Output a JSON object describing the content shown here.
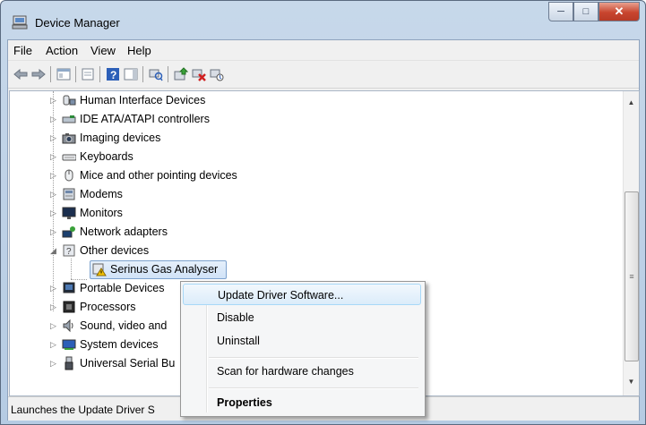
{
  "window": {
    "title": "Device Manager"
  },
  "menubar": [
    "File",
    "Action",
    "View",
    "Help"
  ],
  "tree": {
    "items": [
      {
        "label": "Human Interface Devices",
        "icon": "hid-icon"
      },
      {
        "label": "IDE ATA/ATAPI controllers",
        "icon": "ide-controller-icon"
      },
      {
        "label": "Imaging devices",
        "icon": "camera-icon"
      },
      {
        "label": "Keyboards",
        "icon": "keyboard-icon"
      },
      {
        "label": "Mice and other pointing devices",
        "icon": "mouse-icon"
      },
      {
        "label": "Modems",
        "icon": "modem-icon"
      },
      {
        "label": "Monitors",
        "icon": "monitor-icon"
      },
      {
        "label": "Network adapters",
        "icon": "network-adapter-icon"
      },
      {
        "label": "Other devices",
        "icon": "unknown-device-icon",
        "expanded": true
      },
      {
        "label": "Serinus Gas Analyser",
        "icon": "warning-device-icon",
        "child": true,
        "selected": true
      },
      {
        "label": "Portable Devices",
        "icon": "portable-device-icon"
      },
      {
        "label": "Processors",
        "icon": "processor-icon"
      },
      {
        "label": "Sound, video and",
        "icon": "speaker-icon"
      },
      {
        "label": "System devices",
        "icon": "system-device-icon"
      },
      {
        "label": "Universal Serial Bu",
        "icon": "usb-icon"
      }
    ]
  },
  "context_menu": {
    "items": [
      {
        "label": "Update Driver Software...",
        "highlighted": true
      },
      {
        "label": "Disable"
      },
      {
        "label": "Uninstall"
      },
      {
        "label": "Scan for hardware changes"
      },
      {
        "label": "Properties",
        "bold": true
      }
    ]
  },
  "statusbar": {
    "text": "Launches the Update Driver S"
  },
  "colors": {
    "selection": "#cfe3f8",
    "menu_highlight": "#dbecfa",
    "close_button": "#c8452e"
  }
}
